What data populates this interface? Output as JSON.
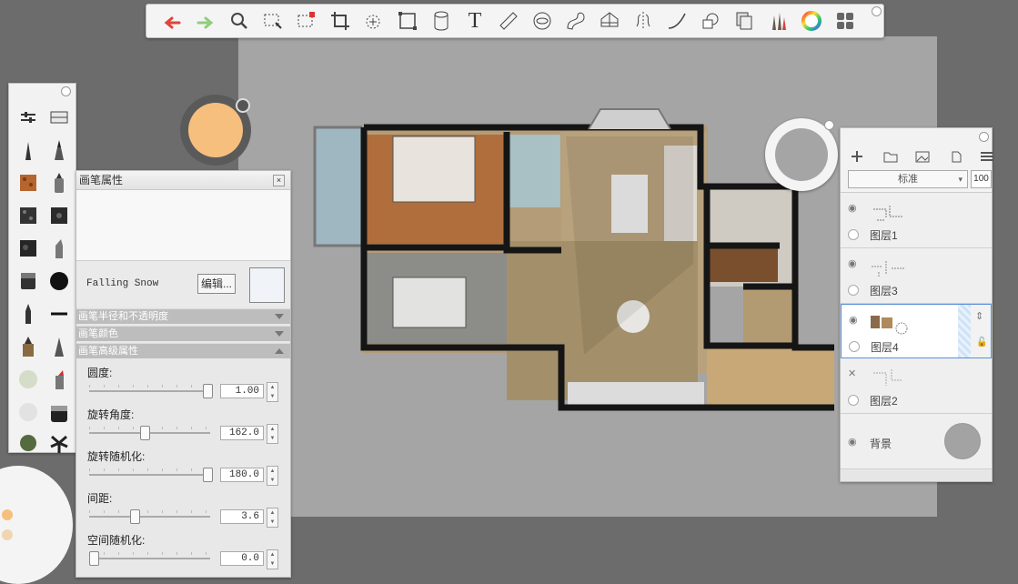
{
  "toolbar": {
    "tools": [
      "undo-icon",
      "redo-icon",
      "zoom-icon",
      "select-icon",
      "quick-select-icon",
      "crop-icon",
      "transform-icon",
      "distort-icon",
      "cylinder-icon",
      "text-icon",
      "ruler-icon",
      "ellipse-guide-icon",
      "french-curve-icon",
      "perspective-icon",
      "symmetry-icon",
      "curve-icon",
      "shape-icon",
      "copy-icon",
      "brush-library-icon",
      "color-wheel-icon",
      "layout-icon"
    ],
    "text_tool_label": "T",
    "accent_undo": "#e0443a",
    "accent_redo": "#8fce7a"
  },
  "toolbox": {
    "tools": [
      "brush-settings-icon",
      "fill-icon",
      "pencil-icon",
      "ink-pen-icon",
      "texture-brush-icon",
      "marker-icon",
      "stamp-brush-icon",
      "stamp-brush-2-icon",
      "paint-brush-icon",
      "airbrush-icon",
      "eraser-icon",
      "dot-brush-icon",
      "fineliner-icon",
      "line-brush-icon",
      "marker-2-icon",
      "calligraphy-icon",
      "sponge-icon",
      "marker-3-icon",
      "blur-icon",
      "smudge-icon",
      "tree-brush-icon",
      "leaf-brush-icon"
    ]
  },
  "brush_color": "#f6bf7e",
  "brush_properties": {
    "title": "画笔属性",
    "brush_name": "Falling Snow",
    "edit_label": "编辑...",
    "sections": [
      {
        "label": "画笔半径和不透明度",
        "expanded": false
      },
      {
        "label": "画笔颜色",
        "expanded": false
      },
      {
        "label": "画笔高级属性",
        "expanded": true
      }
    ],
    "sliders": [
      {
        "label": "圆度:",
        "value": "1.00",
        "fraction": 1.0
      },
      {
        "label": "旋转角度:",
        "value": "162.0",
        "fraction": 0.45
      },
      {
        "label": "旋转随机化:",
        "value": "180.0",
        "fraction": 1.0
      },
      {
        "label": "间距:",
        "value": "3.6",
        "fraction": 0.36
      },
      {
        "label": "空间随机化:",
        "value": "0.0",
        "fraction": 0.0
      }
    ]
  },
  "layers": {
    "blend_mode": "标准",
    "opacity": "100",
    "items": [
      {
        "name": "图层1",
        "visible": true,
        "selected": false
      },
      {
        "name": "图层3",
        "visible": true,
        "selected": false
      },
      {
        "name": "图层4",
        "visible": true,
        "selected": true
      },
      {
        "name": "图层2",
        "visible": false,
        "selected": false
      }
    ],
    "background": {
      "name": "背景",
      "visible": true
    }
  }
}
